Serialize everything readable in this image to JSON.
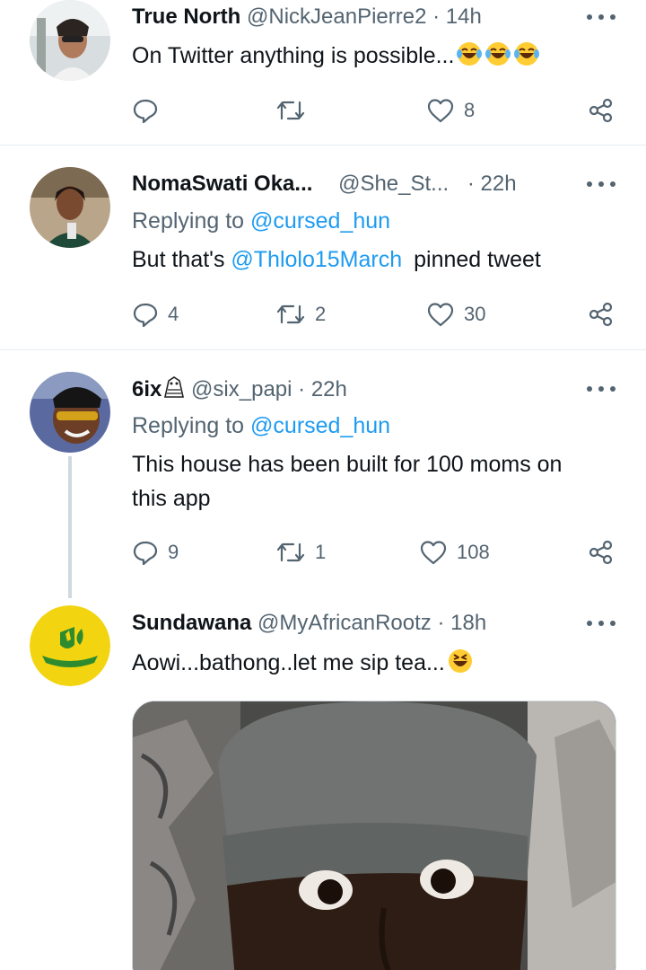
{
  "tweets": [
    {
      "name": "True North",
      "handle": "@NickJeanPierre2",
      "dot": "·",
      "time": "14h",
      "text": "On Twitter anything is possible...",
      "emoji": [
        "laughing-tears-emoji",
        "laughing-tears-emoji",
        "laughing-tears-emoji"
      ],
      "reply_count": "",
      "retweet_count": "",
      "like_count": "8"
    },
    {
      "name": "NomaSwati Oka...",
      "handle": "@She_St...",
      "dot": "·",
      "time": "22h",
      "replying_prefix": "Replying to",
      "replying_handle": "@cursed_hun",
      "text_before": "But that's",
      "mention": "@Thlolo15March",
      "text_after": "pinned tweet",
      "reply_count": "4",
      "retweet_count": "2",
      "like_count": "30"
    },
    {
      "name": "6ix",
      "name_icon": "owl-emoji",
      "handle": "@six_papi",
      "dot": "·",
      "time": "22h",
      "replying_prefix": "Replying to",
      "replying_handle": "@cursed_hun",
      "text_line1": "This house has been built for 100 moms on",
      "text_line2": "this app",
      "reply_count": "9",
      "retweet_count": "1",
      "like_count": "108"
    },
    {
      "name": "Sundawana",
      "handle": "@MyAfricanRootz",
      "dot": "·",
      "time": "18h",
      "text": "Aowi...bathong..let me sip tea...",
      "emoji": [
        "grinning-squinting-emoji"
      ],
      "media": "photo-of-man-in-grey-beanie"
    }
  ],
  "colors": {
    "accent": "#1d9bf0",
    "secondary_text": "#536471",
    "divider": "#e6ecf0",
    "thread_line": "#cfd9de"
  }
}
